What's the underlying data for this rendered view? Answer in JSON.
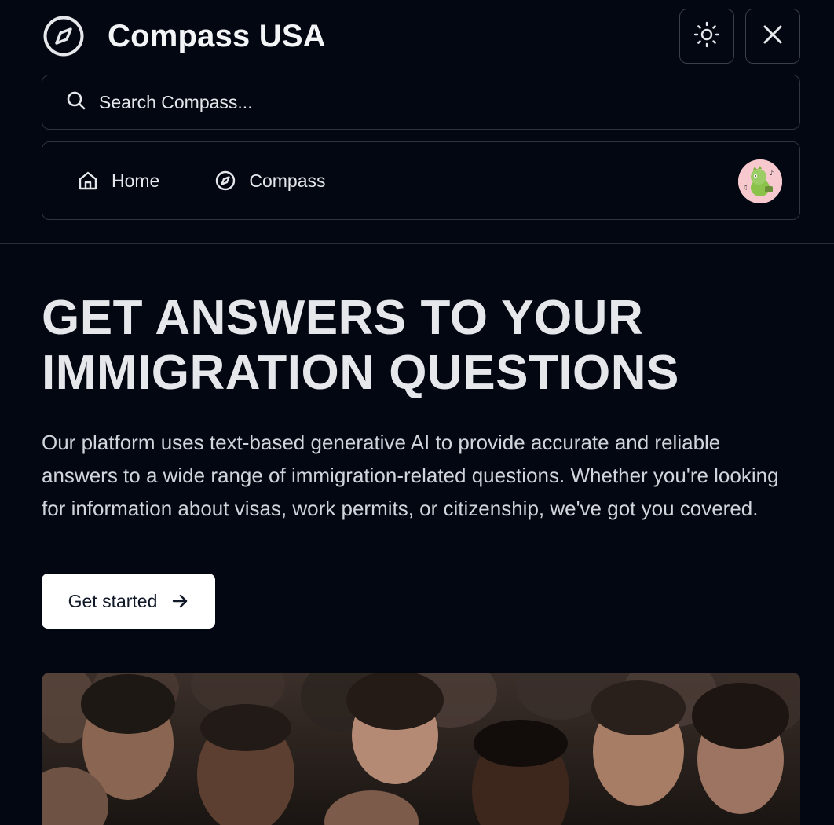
{
  "header": {
    "title": "Compass USA",
    "logo_icon": "compass-icon",
    "theme_toggle_icon": "sun-icon",
    "close_icon": "close-icon"
  },
  "search": {
    "placeholder": "Search Compass..."
  },
  "nav": {
    "items": [
      {
        "label": "Home",
        "icon": "home-icon"
      },
      {
        "label": "Compass",
        "icon": "compass-icon"
      }
    ],
    "avatar": "avatar"
  },
  "hero": {
    "heading": "GET ANSWERS TO YOUR IMMIGRATION QUESTIONS",
    "body": "Our platform uses text-based generative AI to provide accurate and reliable answers to a wide range of immigration-related questions. Whether you're looking for information about visas, work permits, or citizenship, we've got you covered.",
    "cta_label": "Get started"
  },
  "colors": {
    "background": "#030712",
    "text": "#e5e7eb",
    "border": "#2f3440",
    "button_bg": "#ffffff",
    "avatar_bg": "#f7c9cf"
  }
}
